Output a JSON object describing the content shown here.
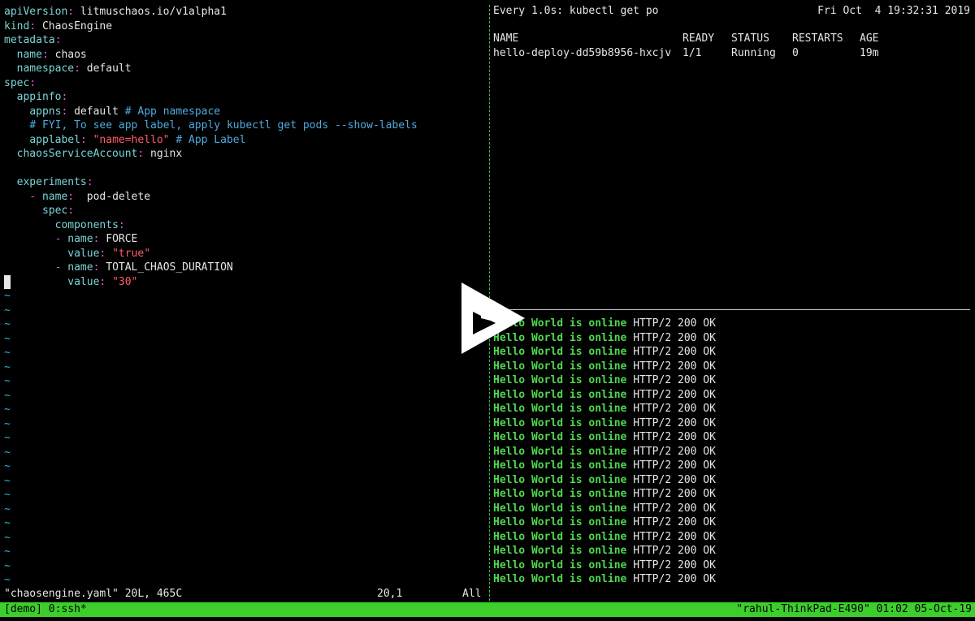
{
  "vim": {
    "lines": [
      {
        "segs": [
          [
            "k",
            "apiVersion"
          ],
          [
            "p",
            ":"
          ],
          [
            "v",
            " litmuschaos.io/v1alpha1"
          ]
        ]
      },
      {
        "segs": [
          [
            "k",
            "kind"
          ],
          [
            "p",
            ":"
          ],
          [
            "v",
            " ChaosEngine"
          ]
        ]
      },
      {
        "segs": [
          [
            "k",
            "metadata"
          ],
          [
            "p",
            ":"
          ]
        ]
      },
      {
        "segs": [
          [
            "v",
            "  "
          ],
          [
            "k",
            "name"
          ],
          [
            "p",
            ":"
          ],
          [
            "v",
            " chaos"
          ]
        ]
      },
      {
        "segs": [
          [
            "v",
            "  "
          ],
          [
            "k",
            "namespace"
          ],
          [
            "p",
            ":"
          ],
          [
            "v",
            " default"
          ]
        ]
      },
      {
        "segs": [
          [
            "k",
            "spec"
          ],
          [
            "p",
            ":"
          ]
        ]
      },
      {
        "segs": [
          [
            "v",
            "  "
          ],
          [
            "k",
            "appinfo"
          ],
          [
            "p",
            ":"
          ]
        ]
      },
      {
        "segs": [
          [
            "v",
            "    "
          ],
          [
            "k",
            "appns"
          ],
          [
            "p",
            ":"
          ],
          [
            "v",
            " default "
          ],
          [
            "c",
            "# App namespace"
          ]
        ]
      },
      {
        "segs": [
          [
            "v",
            "    "
          ],
          [
            "c",
            "# FYI, To see app label, apply kubectl get pods --show-labels"
          ]
        ]
      },
      {
        "segs": [
          [
            "v",
            "    "
          ],
          [
            "k",
            "applabel"
          ],
          [
            "p",
            ":"
          ],
          [
            "v",
            " "
          ],
          [
            "s",
            "\"name=hello\""
          ],
          [
            "v",
            " "
          ],
          [
            "c",
            "# App Label"
          ]
        ]
      },
      {
        "segs": [
          [
            "v",
            "  "
          ],
          [
            "k",
            "chaosServiceAccount"
          ],
          [
            "p",
            ":"
          ],
          [
            "v",
            " nginx"
          ]
        ]
      },
      {
        "segs": [
          [
            "v",
            ""
          ]
        ]
      },
      {
        "segs": [
          [
            "v",
            "  "
          ],
          [
            "k",
            "experiments"
          ],
          [
            "p",
            ":"
          ]
        ]
      },
      {
        "segs": [
          [
            "v",
            "    "
          ],
          [
            "p",
            "-"
          ],
          [
            "v",
            " "
          ],
          [
            "k",
            "name"
          ],
          [
            "p",
            ":"
          ],
          [
            "v",
            "  pod-delete"
          ]
        ]
      },
      {
        "segs": [
          [
            "v",
            "      "
          ],
          [
            "k",
            "spec"
          ],
          [
            "p",
            ":"
          ]
        ]
      },
      {
        "segs": [
          [
            "v",
            "        "
          ],
          [
            "k",
            "components"
          ],
          [
            "p",
            ":"
          ]
        ]
      },
      {
        "segs": [
          [
            "v",
            "        "
          ],
          [
            "p",
            "-"
          ],
          [
            "v",
            " "
          ],
          [
            "k",
            "name"
          ],
          [
            "p",
            ":"
          ],
          [
            "v",
            " FORCE"
          ]
        ]
      },
      {
        "segs": [
          [
            "v",
            "          "
          ],
          [
            "k",
            "value"
          ],
          [
            "p",
            ":"
          ],
          [
            "v",
            " "
          ],
          [
            "s",
            "\"true\""
          ]
        ]
      },
      {
        "segs": [
          [
            "v",
            "        "
          ],
          [
            "p",
            "-"
          ],
          [
            "v",
            " "
          ],
          [
            "k",
            "name"
          ],
          [
            "p",
            ":"
          ],
          [
            "v",
            " TOTAL_CHAOS_DURATION"
          ]
        ]
      },
      {
        "segs": [
          [
            "v",
            "          "
          ],
          [
            "k",
            "value"
          ],
          [
            "p",
            ":"
          ],
          [
            "v",
            " "
          ],
          [
            "s",
            "\"30\""
          ]
        ]
      }
    ],
    "tilde": "~",
    "tilde_count": 21,
    "status_file": "\"chaosengine.yaml\" 20L, 465C",
    "status_pos": "20,1",
    "status_scroll": "All"
  },
  "watch": {
    "title": "Every 1.0s: kubectl get po",
    "time": "Fri Oct  4 19:32:31 2019",
    "headers": [
      "NAME",
      "READY",
      "STATUS",
      "RESTARTS",
      "AGE"
    ],
    "rows": [
      [
        "hello-deploy-dd59b8956-hxcjv",
        "1/1",
        "Running",
        "0",
        "19m"
      ]
    ]
  },
  "curl": {
    "message": "Hello World is online",
    "status": "HTTP/2 200 OK",
    "count": 19
  },
  "tmux": {
    "left": "[demo] 0:ssh*",
    "right": "\"rahul-ThinkPad-E490\" 01:02 05-Oct-19"
  },
  "colors": {
    "background": "#000000",
    "accent_green": "#3ccf2c",
    "ok_green": "#4ed84e",
    "yaml_key": "#7cd4d6",
    "comment": "#4fa8dd",
    "string": "#ff5c6b"
  },
  "icons": {
    "play": "play-icon"
  }
}
